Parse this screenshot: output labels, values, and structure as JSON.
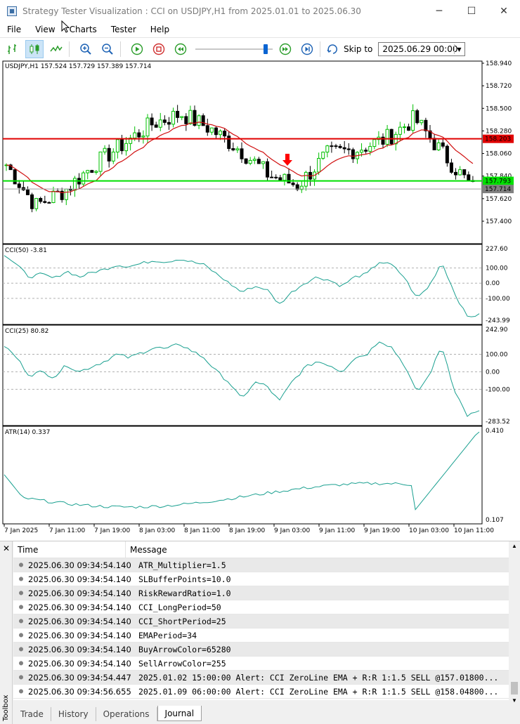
{
  "window": {
    "title": "Strategy Tester Visualization : CCI on USDJPY,H1 from 2025.01.01 to 2025.06.30",
    "minimize": "─",
    "maximize": "☐",
    "close": "✕"
  },
  "menu": [
    "File",
    "View",
    "Charts",
    "Tester",
    "Help"
  ],
  "toolbar": {
    "skip_to_label": "Skip to",
    "skip_to_value": "2025.06.29 00:00",
    "playback_progress": 0.93
  },
  "chart": {
    "symbol_header": "USDJPY,H1  157.524 157.729 157.389 157.714",
    "colors": {
      "bull": "#00c000",
      "bear": "#000000",
      "ema": "#d01010",
      "cci": "#1aa090",
      "sell_line": "#e00000",
      "buy_line": "#00e000",
      "arrow": "#ff0000"
    },
    "price_axis": [
      "158.940",
      "158.720",
      "158.500",
      "158.280",
      "158.060",
      "157.840",
      "157.620",
      "157.400"
    ],
    "price_tags": {
      "sell_level": "158.203",
      "buy_level": "157.793",
      "last_price": "157.714"
    },
    "cci50": {
      "label": "CCI(50) -3.81",
      "axis": [
        "227.60",
        "100.00",
        "0.00",
        "-100.00",
        "-243.99"
      ]
    },
    "cci25": {
      "label": "CCI(25) 80.82",
      "axis": [
        "242.90",
        "100.00",
        "0.00",
        "-100.00",
        "-283.52"
      ]
    },
    "atr": {
      "label": "ATR(14) 0.337",
      "axis": [
        "0.410",
        "0.107"
      ]
    },
    "time_axis": [
      "7 Jan 2025",
      "7 Jan 11:00",
      "7 Jan 19:00",
      "8 Jan 03:00",
      "8 Jan 11:00",
      "8 Jan 19:00",
      "9 Jan 03:00",
      "9 Jan 11:00",
      "9 Jan 19:00",
      "10 Jan 03:00",
      "10 Jan 11:00"
    ]
  },
  "journal": {
    "close": "✕",
    "toolbox_label": "Toolbox",
    "columns": {
      "time": "Time",
      "message": "Message"
    },
    "rows": [
      {
        "time": "2025.06.30 09:34:54.140",
        "message": "ATR_Multiplier=1.5"
      },
      {
        "time": "2025.06.30 09:34:54.140",
        "message": "SLBufferPoints=10.0"
      },
      {
        "time": "2025.06.30 09:34:54.140",
        "message": "RiskRewardRatio=1.0"
      },
      {
        "time": "2025.06.30 09:34:54.140",
        "message": "CCI_LongPeriod=50"
      },
      {
        "time": "2025.06.30 09:34:54.140",
        "message": "CCI_ShortPeriod=25"
      },
      {
        "time": "2025.06.30 09:34:54.140",
        "message": "EMAPeriod=34"
      },
      {
        "time": "2025.06.30 09:34:54.140",
        "message": "BuyArrowColor=65280"
      },
      {
        "time": "2025.06.30 09:34:54.140",
        "message": "SellArrowColor=255"
      },
      {
        "time": "2025.06.30 09:34:54.447",
        "message": "2025.01.02 15:00:00   Alert: CCI ZeroLine EMA + R:R 1:1.5 SELL @157.01800..."
      },
      {
        "time": "2025.06.30 09:34:56.655",
        "message": "2025.01.09 06:00:00   Alert: CCI ZeroLine EMA + R:R 1:1.5 SELL @158.04800..."
      }
    ],
    "tabs": [
      "Trade",
      "History",
      "Operations",
      "Journal"
    ],
    "active_tab": "Journal"
  }
}
